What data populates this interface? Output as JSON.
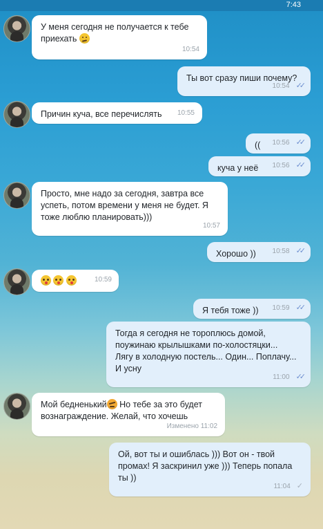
{
  "status_bar": {
    "time": "7:43"
  },
  "messages": [
    {
      "text": "У меня сегодня не получается к тебе приехать",
      "time": "10:54"
    },
    {
      "text": "Ты вот сразу пиши почему?",
      "time": "10:54"
    },
    {
      "text": "Причин куча, все перечислять",
      "time": "10:55"
    },
    {
      "text": "((",
      "time": "10:56"
    },
    {
      "text": "куча у неё",
      "time": "10:56"
    },
    {
      "text": "Просто, мне надо за сегодня, завтра все успеть, потом времени у меня не будет. Я тоже люблю планировать)))",
      "time": "10:57"
    },
    {
      "text": "Хорошо ))",
      "time": "10:58"
    },
    {
      "text": "",
      "time": "10:59"
    },
    {
      "text": "Я тебя тоже ))",
      "time": "10:59"
    },
    {
      "line1": "Тогда я сегодня не тороплюсь домой,",
      "line2": "поужинаю крылышками по-холостяцки...",
      "line3": "Лягу в холодную постель... Один... Поплачу...",
      "line4": "И усну",
      "time": "11:00"
    },
    {
      "text_a": "Мой бедненький",
      "text_b": " Но тебе за это будет вознаграждение. Желай, что хочешь",
      "time": "Изменено 11:02"
    },
    {
      "text": "Ой, вот ты и ошиблась ))) Вот он - твой промах! Я заскринил уже ))) Теперь попала ты ))",
      "time": "11:04"
    }
  ],
  "icons": {
    "read": "double-check-icon",
    "sent": "single-check-icon"
  }
}
